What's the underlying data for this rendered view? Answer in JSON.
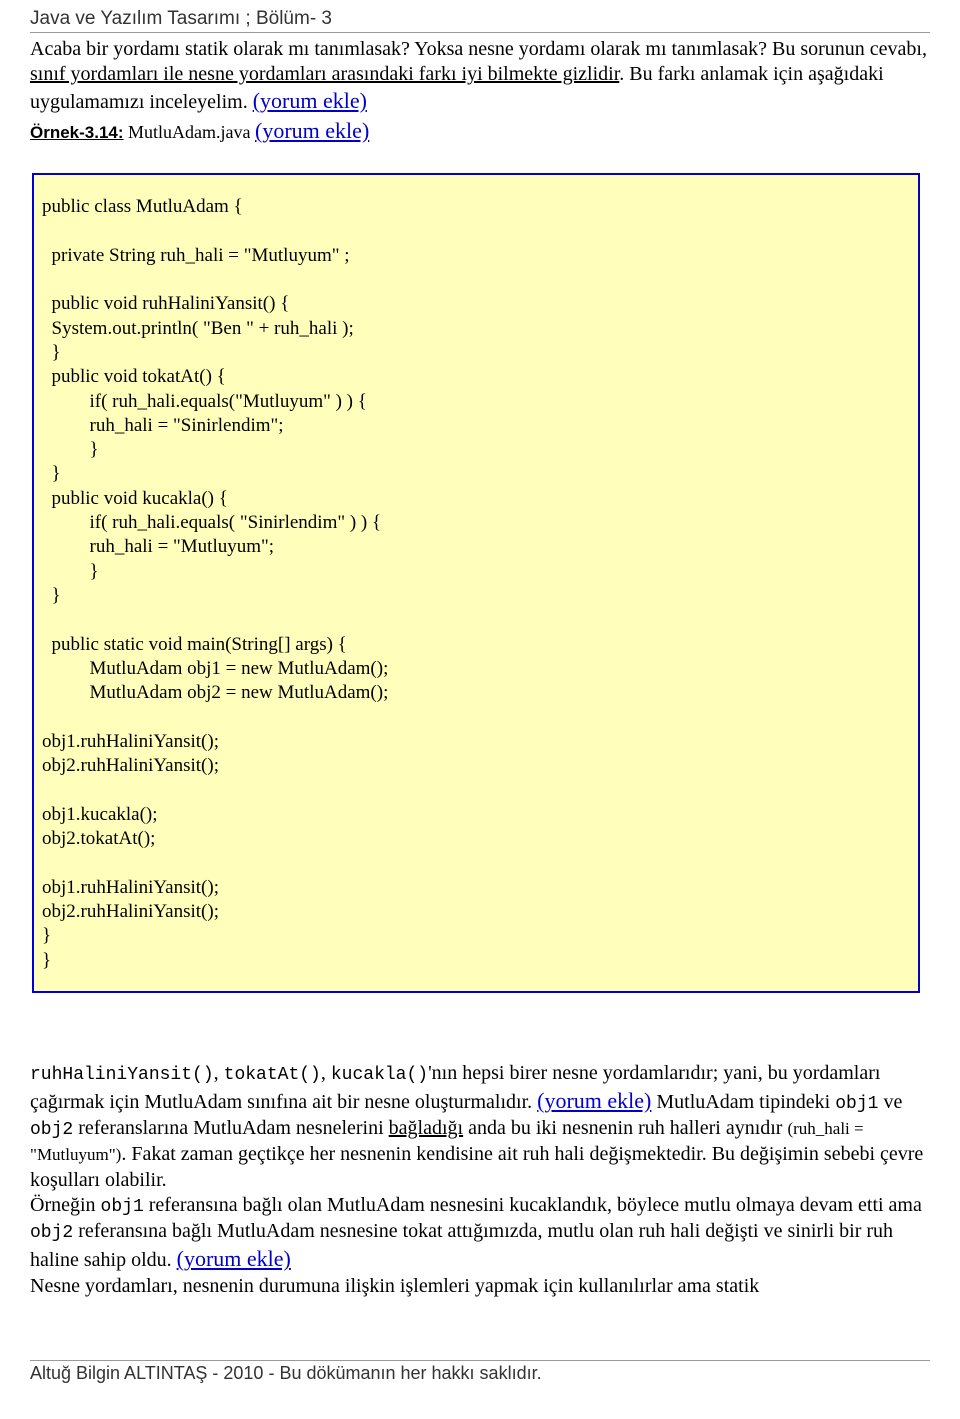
{
  "header": {
    "title": "Java  ve Yazılım Tasarımı ; Bölüm- 3"
  },
  "intro": {
    "p1_a": "Acaba bir yordamı statik olarak mı tanımlasak? Yoksa nesne yordamı olarak mı tanımlasak? Bu sorunun cevabı, ",
    "p1_u": "sınıf yordamları ile nesne yordamları arasındaki farkı iyi bilmekte gizlidir",
    "p1_b": ". Bu farkı anlamak için aşağıdaki uygulamamızı inceleyelim. ",
    "link1": "(yorum ekle)"
  },
  "example": {
    "label": "Örnek-3.14:",
    "file": " MutluAdam.java ",
    "link": "(yorum ekle)"
  },
  "code": "public class MutluAdam {\n\n  private String ruh_hali = \"Mutluyum\" ;\n\n  public void ruhHaliniYansit() {\n  System.out.println( \"Ben \" + ruh_hali );\n  }\n  public void tokatAt() {\n          if( ruh_hali.equals(\"Mutluyum\" ) ) {\n          ruh_hali = \"Sinirlendim\";\n          }\n  }\n  public void kucakla() {\n          if( ruh_hali.equals( \"Sinirlendim\" ) ) {\n          ruh_hali = \"Mutluyum\";\n          }\n  }\n\n  public static void main(String[] args) {\n          MutluAdam obj1 = new MutluAdam();\n          MutluAdam obj2 = new MutluAdam();\n\nobj1.ruhHaliniYansit();\nobj2.ruhHaliniYansit();\n\nobj1.kucakla();\nobj2.tokatAt();\n\nobj1.ruhHaliniYansit();\nobj2.ruhHaliniYansit();\n}\n}",
  "body": {
    "m1": "ruhHaliniYansit()",
    "t1": ", ",
    "m2": "tokatAt()",
    "t2": ", ",
    "m3": "kucakla()",
    "t3": "'nın hepsi birer nesne yordamlarıdır; yani, bu yordamları çağırmak için MutluAdam sınıfına ait bir nesne oluşturmalıdır. ",
    "link2": "(yorum ekle)",
    "t4": " MutluAdam tipindeki ",
    "m4": "obj1",
    "t5": " ve ",
    "m5": "obj2",
    "t6": " referanslarına MutluAdam nesnelerini ",
    "u1": "bağladığı",
    "t7": "  anda bu iki nesnenin ruh halleri aynıdır ",
    "s1": "(ruh_hali = \"Mutluyum\")",
    "t8": ". Fakat zaman geçtikçe her nesnenin kendisine ait ruh hali değişmektedir. Bu değişimin sebebi  çevre koşulları olabilir.",
    "t9": "Örneğin ",
    "m6": "obj1",
    "t10": " referansına bağlı olan MutluAdam nesnesini kucaklandık, böylece mutlu olmaya devam etti ama ",
    "m7": "obj2",
    "t11": " referansına bağlı MutluAdam nesnesine tokat attığımızda, mutlu olan ruh hali değişti ve sinirli bir ruh haline sahip oldu. ",
    "link3": "(yorum ekle)",
    "t12": "Nesne yordamları, nesnenin durumuna ilişkin işlemleri yapmak için kullanılırlar ama statik"
  },
  "footer": {
    "text": "Altuğ Bilgin ALTINTAŞ - 2010 - Bu dökümanın her hakkı saklıdır."
  }
}
